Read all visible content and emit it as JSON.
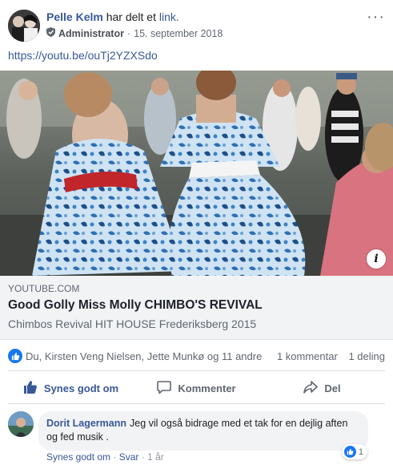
{
  "post": {
    "author": "Pelle Kelm",
    "shared_text": "har delt et",
    "link_word": "link.",
    "role": "Administrator",
    "separator": "·",
    "date": "15. september 2018",
    "more_label": "···",
    "url": "https://youtu.be/ouTj2YZXSdo"
  },
  "link_preview": {
    "domain": "YOUTUBE.COM",
    "title": "Good Golly Miss Molly CHIMBO'S REVIVAL",
    "subtitle": "Chimbos Revival HIT HOUSE Frederiksberg 2015",
    "info_label": "i"
  },
  "reactions": {
    "people": "Du, Kirsten Veng Nielsen, Jette Munkø og 11 andre",
    "comments": "1 kommentar",
    "shares": "1 deling"
  },
  "actions": {
    "like": "Synes godt om",
    "comment": "Kommenter",
    "share": "Del"
  },
  "comment": {
    "author": "Dorit Lagermann",
    "text": "Jeg vil også bidrage med et tak for en dejlig aften og fed musik .",
    "like_action": "Synes godt om",
    "separator": "·",
    "reply_action": "Svar",
    "time": "1 år",
    "reaction_count": "1"
  },
  "colors": {
    "link": "#385898",
    "like_blue": "#1877f2",
    "muted": "#606770",
    "bubble": "#f2f3f5"
  }
}
